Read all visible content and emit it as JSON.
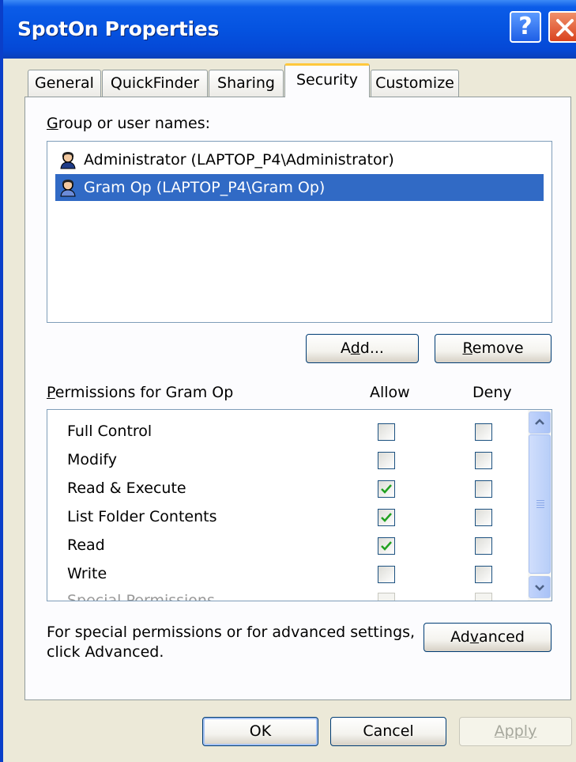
{
  "window": {
    "title": "SpotOn Properties",
    "help_glyph": "?",
    "colors": {
      "titlebar": "#0553E0",
      "selection": "#316AC5",
      "face": "#ECE9D8"
    }
  },
  "tabs": [
    {
      "label": "General"
    },
    {
      "label": "QuickFinder"
    },
    {
      "label": "Sharing"
    },
    {
      "label": "Security",
      "active": true
    },
    {
      "label": "Customize"
    }
  ],
  "security": {
    "group_label_prefix": "G",
    "group_label_rest": "roup or user names:",
    "users": [
      {
        "name": "Administrator (LAPTOP_P4\\Administrator)",
        "icon": "user-icon"
      },
      {
        "name": "Gram Op (LAPTOP_P4\\Gram Op)",
        "icon": "user-icon",
        "selected": true
      }
    ],
    "add_button": {
      "pre": "A",
      "accel": "d",
      "post": "d..."
    },
    "remove_button": {
      "accel": "R",
      "post": "emove"
    },
    "permissions_label_accel": "P",
    "permissions_label_rest": "ermissions for Gram Op",
    "allow_header": "Allow",
    "deny_header": "Deny",
    "permissions": [
      {
        "name": "Full Control",
        "allow": false,
        "deny": false
      },
      {
        "name": "Modify",
        "allow": false,
        "deny": false
      },
      {
        "name": "Read & Execute",
        "allow": true,
        "deny": false
      },
      {
        "name": "List Folder Contents",
        "allow": true,
        "deny": false
      },
      {
        "name": "Read",
        "allow": true,
        "deny": false
      },
      {
        "name": "Write",
        "allow": false,
        "deny": false
      },
      {
        "name": "Special Permissions",
        "allow": false,
        "deny": false,
        "disabled": true
      }
    ],
    "advanced_text_line1": "For special permissions or for advanced settings,",
    "advanced_text_line2": "click Advanced.",
    "advanced_button": {
      "pre": "Ad",
      "accel": "v",
      "post": "anced"
    }
  },
  "footer": {
    "ok_label": "OK",
    "cancel_label": "Cancel",
    "apply_label": "Apply"
  }
}
